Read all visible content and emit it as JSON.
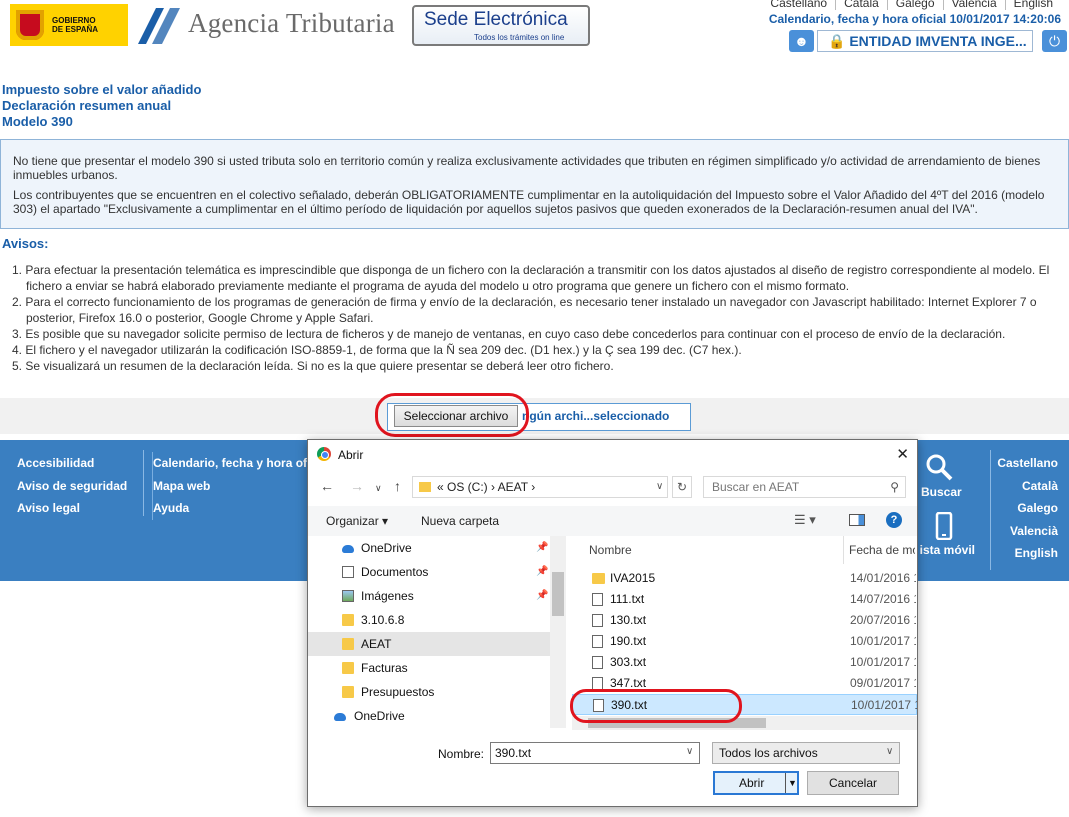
{
  "header": {
    "gov_text": "GOBIERNO\nDE ESPAÑA",
    "agency_name": "Agencia Tributaria",
    "sede_title": "Sede Electrónica",
    "sede_subtitle": "Todos los trámites on line",
    "languages": [
      "Castellano",
      "Català",
      "Galego",
      "Valencia",
      "English"
    ],
    "datetime": "Calendario, fecha y hora oficial 10/01/2017 14:20:06",
    "entity_button": "ENTIDAD IMVENTA INGE..."
  },
  "page": {
    "title_line1": "Impuesto sobre el valor añadido",
    "title_line2": "Declaración resumen anual",
    "title_line3": "Modelo 390",
    "notice_p1": "No tiene que presentar el modelo 390 si usted tributa solo en territorio común y realiza exclusivamente actividades que tributen en régimen simplificado y/o actividad de arrendamiento de bienes inmuebles urbanos.",
    "notice_p2": "Los contribuyentes que se encuentren en el colectivo señalado, deberán OBLIGATORIAMENTE cumplimentar en la autoliquidación del Impuesto sobre el Valor Añadido del 4ºT del 2016 (modelo 303) el apartado \"Exclusivamente a cumplimentar en el último período de liquidación por aquellos sujetos pasivos que queden exonerados de la Declaración-resumen anual del IVA\".",
    "avisos_title": "Avisos:",
    "avisos": [
      "1. Para efectuar la presentación telemática es imprescindible que disponga de un fichero con la declaración a transmitir con los datos ajustados al diseño de registro correspondiente al modelo. El fichero a enviar se habrá elaborado previamente mediante el programa de ayuda del modelo u otro programa que genere un fichero con el mismo formato.",
      "2. Para el correcto funcionamiento de los programas de generación de firma y envío de la declaración, es necesario tener instalado un navegador con Javascript habilitado: Internet Explorer 7 o posterior, Firefox 16.0 o posterior, Google Chrome y Apple Safari.",
      "3. Es posible que su navegador solicite permiso de lectura de ficheros y de manejo de ventanas, en cuyo caso debe concederlos para continuar con el proceso de envío de la declaración.",
      "4. El fichero y el navegador utilizarán la codificación ISO-8859-1, de forma que la Ñ sea 209 dec. (D1 hex.) y la Ç sea 199 dec. (C7 hex.).",
      "5. Se visualizará un resumen de la declaración leída. Si no es la que quiere presentar se deberá leer otro fichero."
    ],
    "select_file_button": "Seleccionar archivo",
    "no_file_text": "ngún archi...seleccionado"
  },
  "footer": {
    "col1": [
      "Accesibilidad",
      "Aviso de seguridad",
      "Aviso legal"
    ],
    "col2": [
      "Calendario, fecha y hora ofic",
      "Mapa web",
      "Ayuda"
    ],
    "search": "Buscar",
    "mobile": "ista móvil",
    "languages": [
      "Castellano",
      "Català",
      "Galego",
      "Valencià",
      "English"
    ]
  },
  "dialog": {
    "title": "Abrir",
    "address": "«  OS (C:)  ›  AEAT  ›",
    "search_placeholder": "Buscar en AEAT",
    "organize": "Organizar ▾",
    "new_folder": "Nueva carpeta",
    "nav_items": [
      {
        "label": "OneDrive",
        "icon": "cloud",
        "pinned": true
      },
      {
        "label": "Documentos",
        "icon": "doc",
        "pinned": true
      },
      {
        "label": "Imágenes",
        "icon": "img",
        "pinned": true
      },
      {
        "label": "3.10.6.8",
        "icon": "folder",
        "pinned": false
      },
      {
        "label": "AEAT",
        "icon": "folder",
        "pinned": false
      },
      {
        "label": "Facturas",
        "icon": "folder",
        "pinned": false
      },
      {
        "label": "Presupuestos",
        "icon": "folder",
        "pinned": false
      },
      {
        "label": "OneDrive",
        "icon": "cloud",
        "pinned": false
      }
    ],
    "column_name": "Nombre",
    "column_date": "Fecha de mo",
    "files": [
      {
        "name": "IVA2015",
        "date": "14/01/2016 1",
        "type": "folder"
      },
      {
        "name": "111.txt",
        "date": "14/07/2016 1",
        "type": "file"
      },
      {
        "name": "130.txt",
        "date": "20/07/2016 1",
        "type": "file"
      },
      {
        "name": "190.txt",
        "date": "10/01/2017 1",
        "type": "file"
      },
      {
        "name": "303.txt",
        "date": "10/01/2017 1",
        "type": "file"
      },
      {
        "name": "347.txt",
        "date": "09/01/2017 1",
        "type": "file"
      },
      {
        "name": "390.txt",
        "date": "10/01/2017 1",
        "type": "file"
      }
    ],
    "selected_file": "390.txt",
    "filename_label": "Nombre:",
    "filename_value": "390.txt",
    "filetype": "Todos los archivos",
    "open_button": "Abrir",
    "cancel_button": "Cancelar"
  }
}
